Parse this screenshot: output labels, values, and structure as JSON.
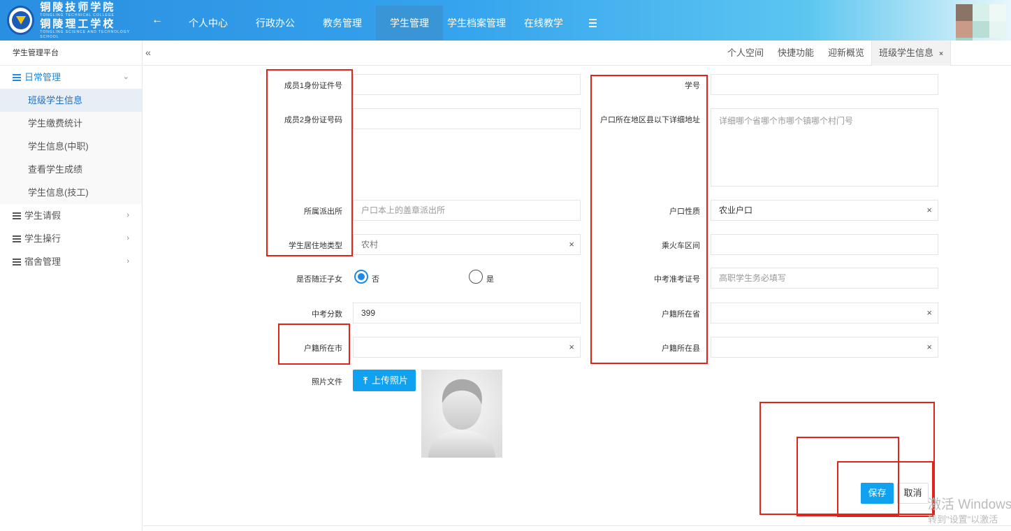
{
  "header": {
    "school_name_1": "铜陵技师学院",
    "school_en_1": "TONGLING TECHNICAL COLLEGE",
    "school_name_2": "铜陵理工学校",
    "school_en_2": "TONGLING SCIENCE AND TECHNOLOGY SCHOOL",
    "nav": [
      {
        "label": "个人中心"
      },
      {
        "label": "行政办公"
      },
      {
        "label": "教务管理"
      },
      {
        "label": "学生管理",
        "active": true
      },
      {
        "label": "学生档案管理"
      },
      {
        "label": "在线教学"
      }
    ],
    "back_icon": "arrow-left-icon",
    "menu_icon": "hamburger-icon"
  },
  "sidebar": {
    "title": "学生管理平台",
    "groups": [
      {
        "label": "日常管理",
        "open": true,
        "items": [
          {
            "label": "班级学生信息",
            "active": true
          },
          {
            "label": "学生缴费统计"
          },
          {
            "label": "学生信息(中职)"
          },
          {
            "label": "查看学生成绩"
          },
          {
            "label": "学生信息(技工)"
          }
        ]
      },
      {
        "label": "学生请假"
      },
      {
        "label": "学生操行"
      },
      {
        "label": "宿舍管理"
      }
    ]
  },
  "tabbar": {
    "collapse": "«",
    "tabs": [
      {
        "label": "个人空间"
      },
      {
        "label": "快捷功能"
      },
      {
        "label": "迎新概览"
      },
      {
        "label": "班级学生信息",
        "active": true,
        "close": "×"
      }
    ]
  },
  "form": {
    "member1_id_label": "成员1身份证件号",
    "member1_id_value": "",
    "member2_id_label": "成员2身份证号码",
    "member2_id_value": "",
    "police_label": "所属派出所",
    "police_placeholder": "户口本上的盖章派出所",
    "residence_type_label": "学生居住地类型",
    "residence_type_value": "农村",
    "migrant_label": "是否随迁子女",
    "migrant_no": "否",
    "migrant_yes": "是",
    "exam_score_label": "中考分数",
    "exam_score_value": "399",
    "city_label": "户籍所在市",
    "city_value": "",
    "photo_label": "照片文件",
    "upload_label": "上传照片",
    "student_no_label": "学号",
    "student_no_value": "",
    "address_label": "户口所在地区县以下详细地址",
    "address_placeholder": "详细哪个省哪个市哪个镇哪个村门号",
    "hukou_type_label": "户口性质",
    "hukou_type_value": "农业户口",
    "train_label": "乘火车区间",
    "train_value": "",
    "exam_no_label": "中考准考证号",
    "exam_no_placeholder": "高职学生务必填写",
    "province_label": "户籍所在省",
    "province_value": "",
    "county_label": "户籍所在县",
    "county_value": "",
    "clear": "×"
  },
  "actions": {
    "save": "保存",
    "cancel": "取消"
  },
  "watermark": {
    "line1": "激活 Windows",
    "line2": "转到\"设置\"以激活"
  },
  "colors": {
    "accent": "#10a2f0",
    "highlight_box": "#e2231a",
    "sidebar_active": "#1e8ae3"
  }
}
